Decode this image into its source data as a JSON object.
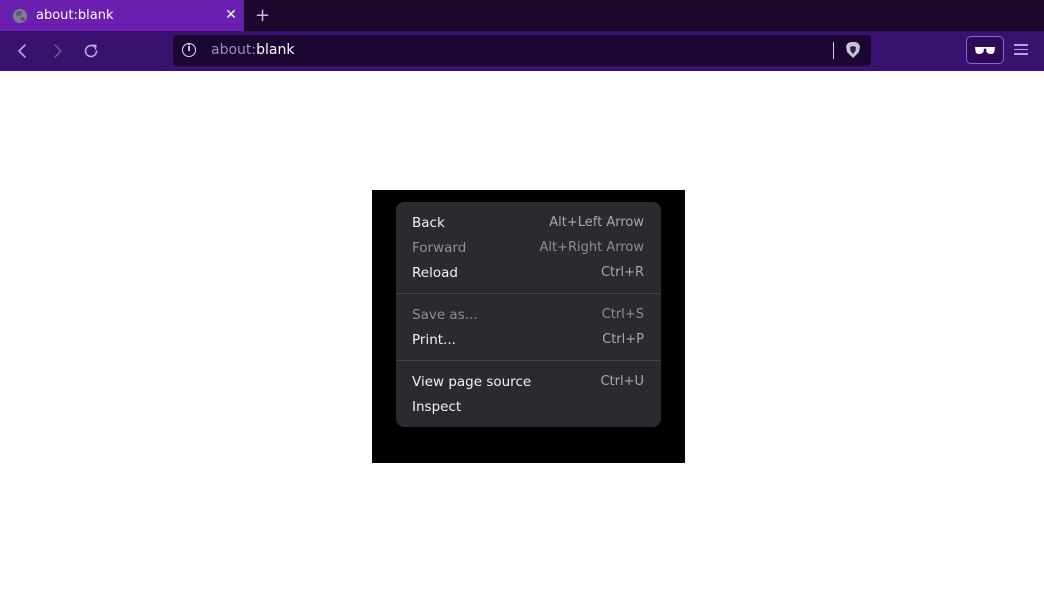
{
  "tabs": [
    {
      "title": "about:blank",
      "icon": "globe-icon"
    }
  ],
  "tab_close_glyph": "✕",
  "new_tab_glyph": "+",
  "toolbar": {
    "back_icon": "back-arrow-icon",
    "forward_icon": "forward-arrow-icon",
    "reload_icon": "reload-icon",
    "info_glyph": "i",
    "url_scheme": "about:",
    "url_host": "blank",
    "shield_icon": "brave-shield-icon",
    "private_icon": "private-window-icon",
    "menu_icon": "hamburger-menu-icon"
  },
  "context_menu": {
    "groups": [
      [
        {
          "label": "Back",
          "shortcut": "Alt+Left Arrow",
          "enabled": true
        },
        {
          "label": "Forward",
          "shortcut": "Alt+Right Arrow",
          "enabled": false
        },
        {
          "label": "Reload",
          "shortcut": "Ctrl+R",
          "enabled": true
        }
      ],
      [
        {
          "label": "Save as...",
          "shortcut": "Ctrl+S",
          "enabled": false
        },
        {
          "label": "Print...",
          "shortcut": "Ctrl+P",
          "enabled": true
        }
      ],
      [
        {
          "label": "View page source",
          "shortcut": "Ctrl+U",
          "enabled": true
        },
        {
          "label": "Inspect",
          "shortcut": "",
          "enabled": true
        }
      ]
    ]
  },
  "colors": {
    "tab_active": "#6a1fb0",
    "tabstrip_bg": "#1c0a2e",
    "toolbar_bg": "#3b1170",
    "urlbar_bg": "#1b0633",
    "menu_bg": "#2b2b2f"
  }
}
